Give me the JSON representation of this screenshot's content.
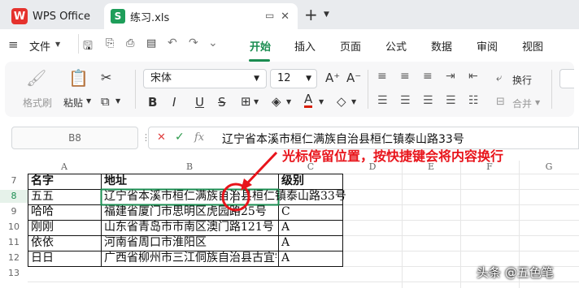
{
  "tabs": {
    "wps_label": "WPS Office",
    "file_label": "练习.xls"
  },
  "menu": {
    "file_menu": "文件",
    "items": [
      "开始",
      "插入",
      "页面",
      "公式",
      "数据",
      "审阅",
      "视图"
    ],
    "active": "开始"
  },
  "ribbon": {
    "format_painter": "格式刷",
    "paste": "粘贴",
    "font_name": "宋体",
    "font_size": "12",
    "wrap_text": "换行",
    "merge": "合并",
    "accent_color": "#1a8c50"
  },
  "formula_bar": {
    "cell_ref": "B8",
    "fx_label": "fx",
    "content": "辽宁省本溪市桓仁满族自治县桓仁镇泰山路33号"
  },
  "sheet": {
    "columns": [
      "A",
      "B",
      "C",
      "D",
      "E",
      "F",
      "G"
    ],
    "rows": [
      "7",
      "8",
      "9",
      "10",
      "11",
      "12",
      "13"
    ],
    "header": {
      "name": "名字",
      "address": "地址",
      "level": "级别"
    },
    "records": [
      {
        "name": "五五",
        "address": "辽宁省本溪市桓仁满族自治县桓仁镇泰山路33号",
        "level": ""
      },
      {
        "name": "哈哈",
        "address": "福建省厦门市思明区虎园路25号",
        "level": "C"
      },
      {
        "name": "刚刚",
        "address": "山东省青岛市市南区澳门路121号",
        "level": "A"
      },
      {
        "name": "依依",
        "address": "河南省周口市淮阳区",
        "level": "A"
      },
      {
        "name": "日日",
        "address": "广西省柳州市三江侗族自治县古宜镇",
        "level": "A"
      }
    ]
  },
  "annotation": {
    "text": "光标停留位置，按快捷键会将内容换行",
    "color": "#e8141b"
  },
  "watermark": "头条 @五色笔"
}
